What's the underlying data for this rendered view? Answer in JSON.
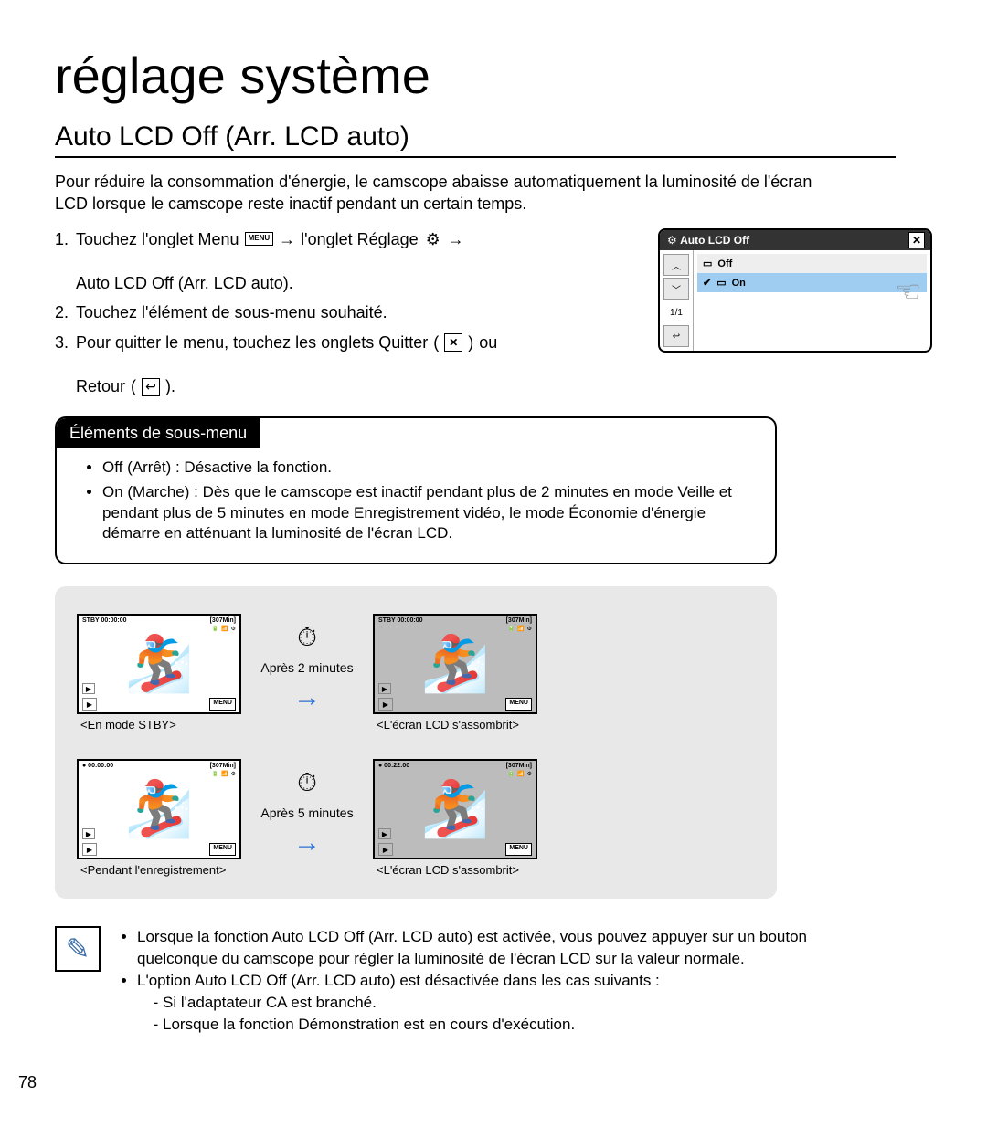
{
  "page_title": "réglage système",
  "section_title": "Auto LCD Off (Arr. LCD auto)",
  "intro": "Pour réduire la consommation d'énergie, le camscope abaisse automatiquement la luminosité de l'écran LCD lorsque le camscope reste inactif pendant un certain temps.",
  "steps": {
    "s1a": "Touchez l'onglet Menu",
    "s1b": "l'onglet Réglage",
    "s1c": "Auto LCD Off (Arr. LCD auto).",
    "s2": "Touchez l'élément de sous-menu souhaité.",
    "s3a": "Pour quitter le menu, touchez les onglets Quitter",
    "s3b": "ou",
    "s3c": "Retour",
    "menu_label": "MENU"
  },
  "menu_screenshot": {
    "title": "Auto LCD Off",
    "off": "Off",
    "on": "On",
    "page": "1/1"
  },
  "submenu": {
    "header": "Éléments de sous-menu",
    "off": "Off (Arrêt) : Désactive la fonction.",
    "on": "On (Marche) : Dès que le camscope est inactif pendant plus de 2 minutes en mode Veille et pendant plus de 5 minutes en mode Enregistrement vidéo, le mode Économie d'énergie démarre en atténuant la luminosité de l'écran LCD."
  },
  "diagram": {
    "topbar_stby": "STBY  00:00:00",
    "topbar_rec": "●  00:00:00",
    "topbar_rec_after": "●  00:22:00",
    "topbar_right": "[307Min]",
    "after2": "Après 2 minutes",
    "after5": "Après 5 minutes",
    "caption_stby": "<En mode STBY>",
    "caption_rec": "<Pendant l'enregistrement>",
    "caption_dim": "<L'écran LCD s'assombrit>",
    "menu_btn": "MENU"
  },
  "notes": {
    "n1": "Lorsque la fonction Auto LCD Off (Arr. LCD auto) est activée, vous pouvez appuyer sur un bouton quelconque du camscope pour régler la luminosité de l'écran LCD sur la valeur normale.",
    "n2": "L'option Auto LCD Off (Arr. LCD auto) est désactivée dans les cas suivants :",
    "n2a": "Si l'adaptateur CA est branché.",
    "n2b": "Lorsque la fonction Démonstration est en cours d'exécution."
  },
  "page_number": "78"
}
